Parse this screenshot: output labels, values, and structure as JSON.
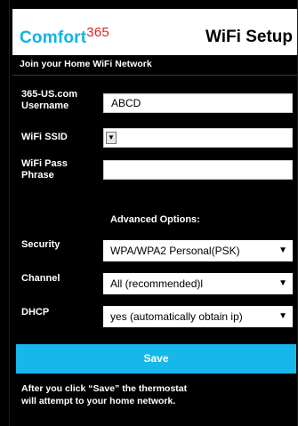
{
  "header": {
    "logo_text": "Comfort",
    "logo_superscript": "365",
    "title": "WiFi Setup",
    "colors": {
      "logo": "#12b3e6",
      "logo_superscript": "#e02020"
    }
  },
  "subheader": "Join your Home WiFi Network",
  "fields": {
    "username": {
      "label_line1": "365-US.com",
      "label_line2": "Username",
      "value": "ABCD"
    },
    "ssid": {
      "label": "WiFi SSID",
      "value": "",
      "arrow": "▼"
    },
    "passphrase": {
      "label_line1": "WiFi Pass",
      "label_line2": "Phrase",
      "value": ""
    }
  },
  "advanced": {
    "heading": "Advanced Options:",
    "security": {
      "label": "Security",
      "selected": "WPA/WPA2 Personal(PSK)",
      "arrow": "▼"
    },
    "channel": {
      "label": "Channel",
      "selected": "All (recommended)l",
      "arrow": "▼"
    },
    "dhcp": {
      "label": "DHCP",
      "selected": "yes (automatically obtain ip)",
      "arrow": "▼"
    }
  },
  "save_button": {
    "label": "Save",
    "color": "#16b8ea"
  },
  "note": {
    "line1": "After you click “Save” the thermostat",
    "line2": "will attempt to your home network."
  }
}
